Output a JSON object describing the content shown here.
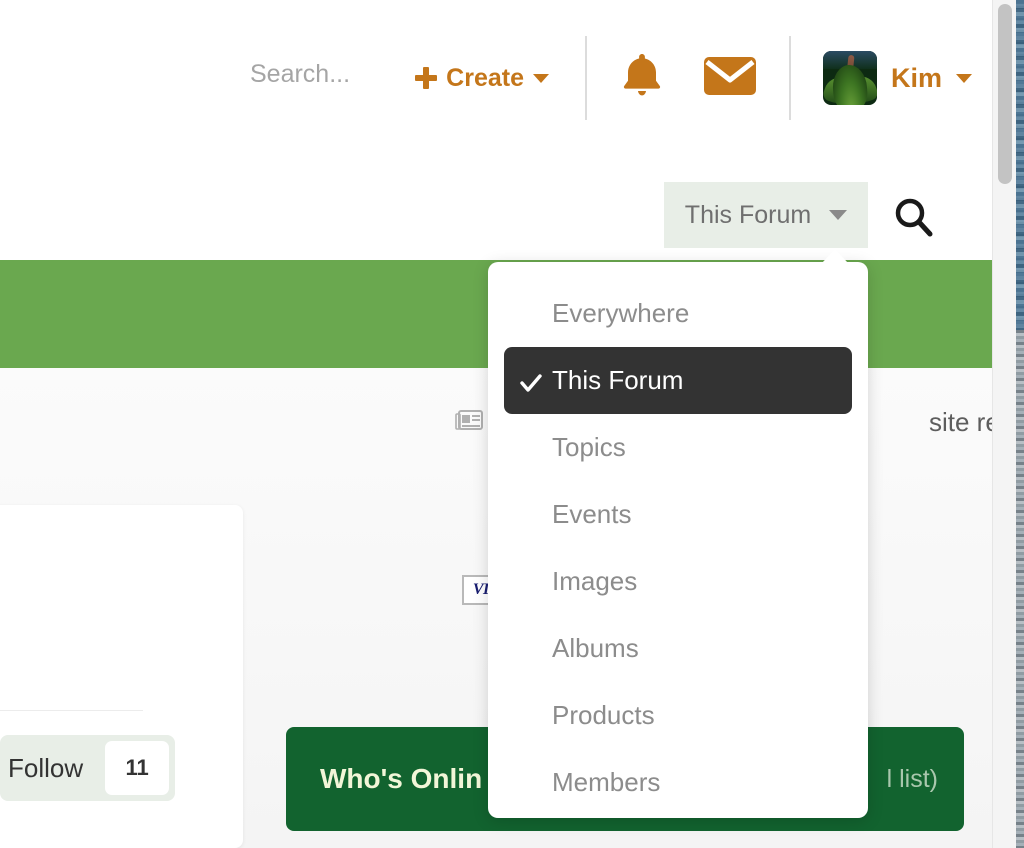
{
  "theme": {
    "accent_orange": "#c4761a",
    "banner_green": "#6aa84f",
    "dark_green": "#12632f",
    "scope_bg": "#e8eee7",
    "active_item_bg": "#333333"
  },
  "userbar": {
    "create_label": "Create",
    "create_icon": "plus-icon",
    "notifications_icon": "bell-icon",
    "messages_icon": "envelope-icon",
    "avatar_icon": "avatar-plant-photo",
    "username": "Kim",
    "user_caret_icon": "chevron-down-icon"
  },
  "search": {
    "placeholder": "Search...",
    "value": "",
    "scope_selected": "This Forum",
    "scope_caret_icon": "chevron-down-icon",
    "submit_icon": "magnifier-icon"
  },
  "scope_dropdown": {
    "selected": "This Forum",
    "check_icon": "check-icon",
    "items": [
      {
        "label": "Everywhere",
        "selected": false
      },
      {
        "label": "This Forum",
        "selected": true
      },
      {
        "label": "Topics",
        "selected": false
      },
      {
        "label": "Events",
        "selected": false
      },
      {
        "label": "Images",
        "selected": false
      },
      {
        "label": "Albums",
        "selected": false
      },
      {
        "label": "Products",
        "selected": false
      },
      {
        "label": "Members",
        "selected": false
      }
    ]
  },
  "content": {
    "mark_read_icon": "newspaper-icon",
    "mark_read_label": "site read",
    "payment_badge_icon": "visa-card-icon",
    "payment_badge_label": "VIS"
  },
  "follow_widget": {
    "label": "Follow",
    "count": "11"
  },
  "whos_online": {
    "title": "Who's Onlin",
    "subtitle": "l list)"
  },
  "scrollbar": {
    "thumb_position_percent": 0
  }
}
